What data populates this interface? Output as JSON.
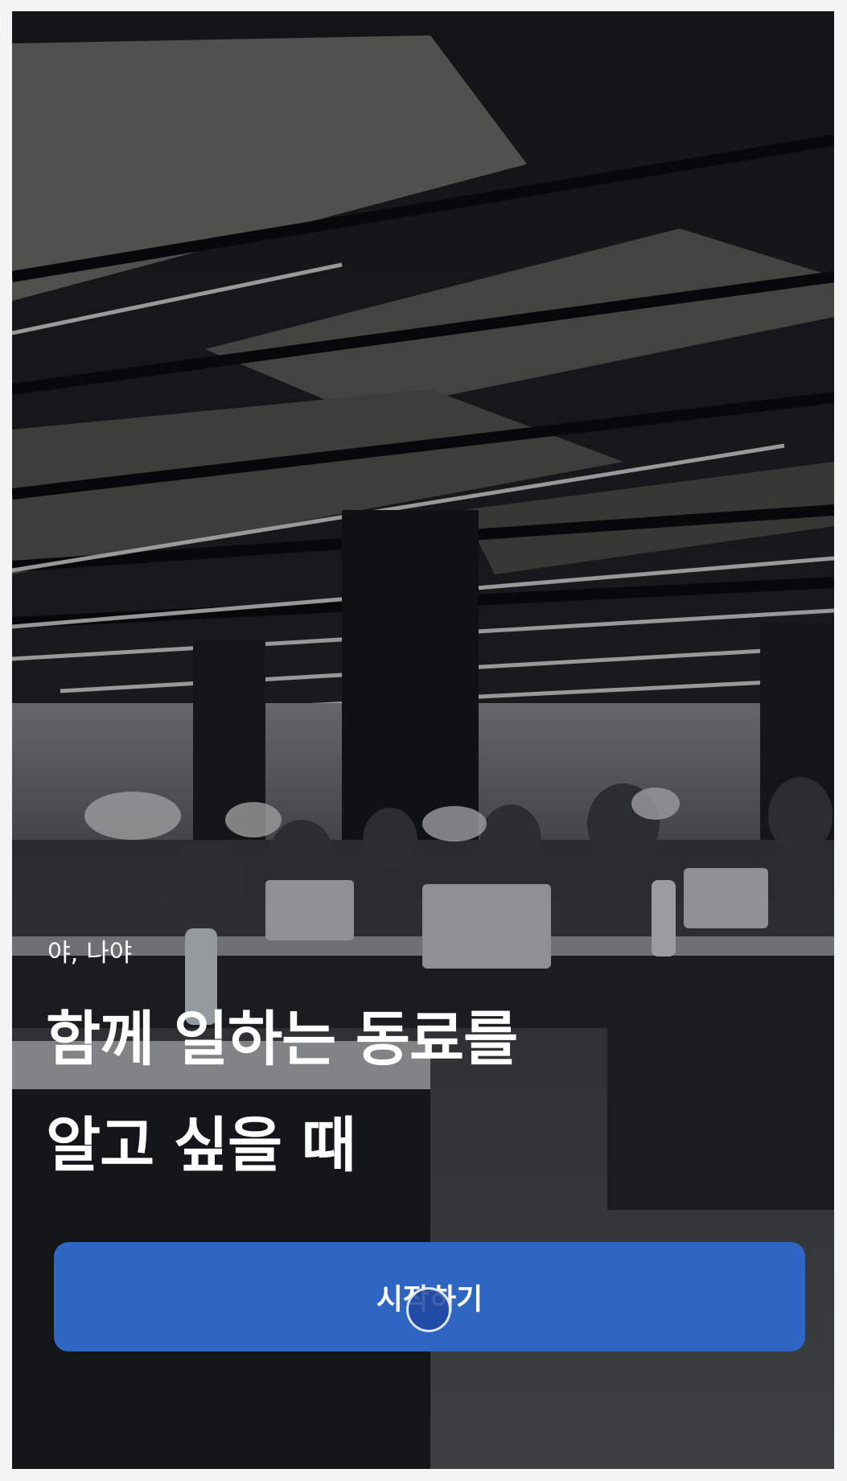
{
  "intro": {
    "subtitle": "야, 나야",
    "headline_line1": "함께 일하는 동료를",
    "headline_line2": "알고 싶을 때"
  },
  "actions": {
    "start_label": "시작하기"
  },
  "background": {
    "description_icon": "office-photo"
  },
  "colors": {
    "button": "#2f66c3",
    "text": "#ffffff"
  }
}
